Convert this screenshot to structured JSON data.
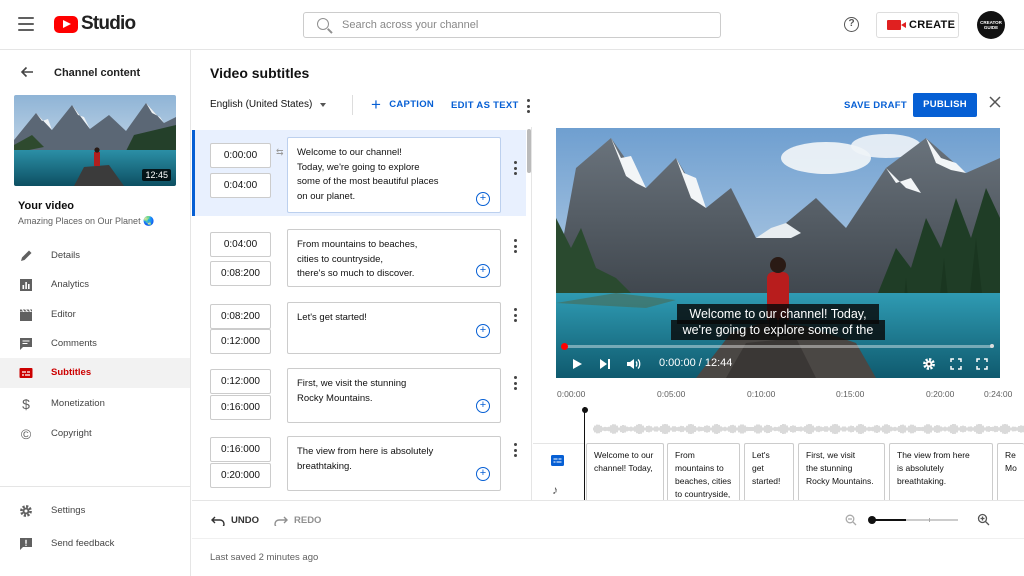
{
  "header": {
    "brand": "Studio",
    "search_placeholder": "Search across your channel",
    "create_label": "CREATE",
    "avatar_text_1": "CREATOR",
    "avatar_text_2": "GUIDE"
  },
  "sidebar": {
    "back_title": "Channel content",
    "thumb_duration": "12:45",
    "your_video_label": "Your video",
    "video_title": "Amazing Places on Our Planet 🌏",
    "items": [
      {
        "label": "Details",
        "icon": "pencil-icon",
        "active": false
      },
      {
        "label": "Analytics",
        "icon": "analytics-icon",
        "active": false
      },
      {
        "label": "Editor",
        "icon": "clapperboard-icon",
        "active": false
      },
      {
        "label": "Comments",
        "icon": "comment-icon",
        "active": false
      },
      {
        "label": "Subtitles",
        "icon": "subtitles-icon",
        "active": true
      },
      {
        "label": "Monetization",
        "icon": "dollar-icon",
        "active": false
      },
      {
        "label": "Copyright",
        "icon": "copyright-icon",
        "active": false
      }
    ],
    "settings_label": "Settings",
    "feedback_label": "Send feedback"
  },
  "editor": {
    "title": "Video subtitles",
    "language": "English (United States)",
    "caption_button": "CAPTION",
    "edit_as_text": "EDIT AS TEXT",
    "save_draft": "SAVE DRAFT",
    "publish": "PUBLISH"
  },
  "captions": [
    {
      "start": "0:00:00",
      "end": "0:04:00",
      "lines": [
        "Welcome to our channel!",
        "Today, we're going to explore",
        "some of the most beautiful places",
        "on our planet."
      ],
      "selected": true
    },
    {
      "start": "0:04:00",
      "end": "0:08:200",
      "lines": [
        "From mountains to beaches,",
        "cities to countryside,",
        "there's so much to discover."
      ],
      "selected": false
    },
    {
      "start": "0:08:200",
      "end": "0:12:000",
      "lines": [
        "Let's get started!"
      ],
      "selected": false
    },
    {
      "start": "0:12:000",
      "end": "0:16:000",
      "lines": [
        "First, we visit the stunning",
        "Rocky Mountains."
      ],
      "selected": false
    },
    {
      "start": "0:16:000",
      "end": "0:20:000",
      "lines": [
        "The view from here is absolutely",
        "breathtaking."
      ],
      "selected": false
    }
  ],
  "player": {
    "subtitle_line1": "Welcome to our channel! Today,",
    "subtitle_line2": "we're going to explore some of the",
    "time_display": "0:00:00 / 12:44",
    "progress_fraction": 0.0
  },
  "timeline": {
    "ticks": [
      "0:00:00",
      "0:05:00",
      "0:10:00",
      "0:15:00",
      "0:20:00",
      "0:24:00"
    ],
    "clips": [
      [
        "Welcome to our",
        "channel! Today,"
      ],
      [
        "From",
        "mountains to",
        "beaches, cities",
        "to countryside,"
      ],
      [
        "Let's",
        "get",
        "started!"
      ],
      [
        "First, we visit",
        "the stunning",
        "Rocky Mountains."
      ],
      [
        "The view from here",
        "is absolutely",
        "breathtaking."
      ],
      [
        "Re",
        "Mo"
      ]
    ]
  },
  "bottom": {
    "undo": "UNDO",
    "redo": "REDO",
    "last_saved": "Last saved 2 minutes ago",
    "zoom_fraction": 0.4
  }
}
